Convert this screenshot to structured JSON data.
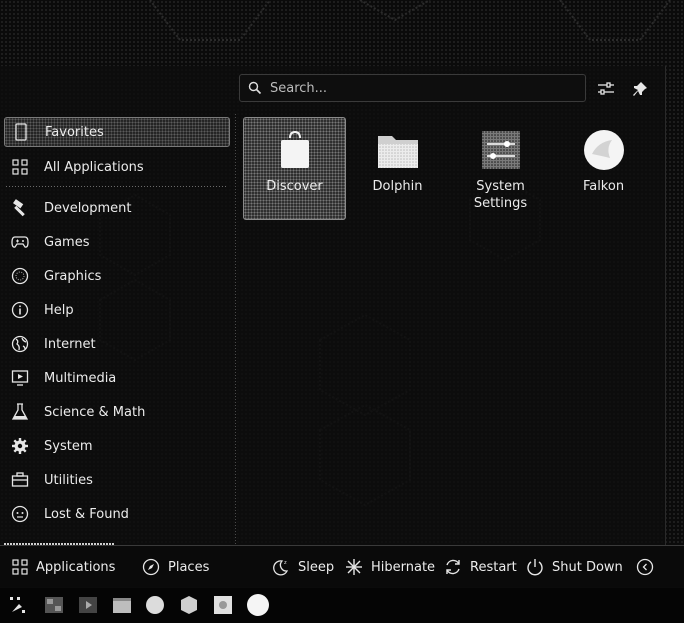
{
  "search": {
    "placeholder": "Search..."
  },
  "header": {
    "configure_icon": "sliders-icon",
    "pin_icon": "pin-icon"
  },
  "sidebar": {
    "items": [
      {
        "label": "Favorites",
        "icon": "bookmark-icon",
        "selected": true
      },
      {
        "label": "All Applications",
        "icon": "grid-icon"
      },
      {
        "label": "Development",
        "icon": "hammer-icon"
      },
      {
        "label": "Games",
        "icon": "gamepad-icon"
      },
      {
        "label": "Graphics",
        "icon": "palette-icon"
      },
      {
        "label": "Help",
        "icon": "info-icon"
      },
      {
        "label": "Internet",
        "icon": "globe-icon"
      },
      {
        "label": "Multimedia",
        "icon": "monitor-play-icon"
      },
      {
        "label": "Science & Math",
        "icon": "flask-icon"
      },
      {
        "label": "System",
        "icon": "gear-icon"
      },
      {
        "label": "Utilities",
        "icon": "toolbox-icon"
      },
      {
        "label": "Lost & Found",
        "icon": "face-icon"
      }
    ]
  },
  "favorites": [
    {
      "label": "Discover",
      "icon": "shopping-bag-icon",
      "selected": true
    },
    {
      "label": "Dolphin",
      "icon": "folder-icon"
    },
    {
      "label": "System Settings",
      "icon": "settings-panel-icon"
    },
    {
      "label": "Falkon",
      "icon": "falkon-icon"
    }
  ],
  "bottom": {
    "applications": "Applications",
    "places": "Places",
    "sleep": "Sleep",
    "hibernate": "Hibernate",
    "restart": "Restart",
    "shutdown": "Shut Down"
  }
}
